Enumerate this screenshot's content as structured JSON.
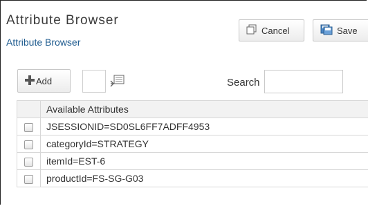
{
  "header": {
    "title": "Attribute Browser",
    "subtitle": "Attribute Browser"
  },
  "actions": {
    "cancel_label": "Cancel",
    "save_label": "Save"
  },
  "toolbar": {
    "add_label": "Add",
    "search_label": "Search",
    "search_value": ""
  },
  "table": {
    "header": "Available Attributes",
    "rows": [
      {
        "label": "JSESSIONID=SD0SL6FF7ADFF4953",
        "checked": false
      },
      {
        "label": "categoryId=STRATEGY",
        "checked": false
      },
      {
        "label": "itemId=EST-6",
        "checked": false
      },
      {
        "label": "productId=FS-SG-G03",
        "checked": false
      }
    ]
  },
  "colors": {
    "subtitle": "#1d5a8e",
    "border": "#222222"
  }
}
